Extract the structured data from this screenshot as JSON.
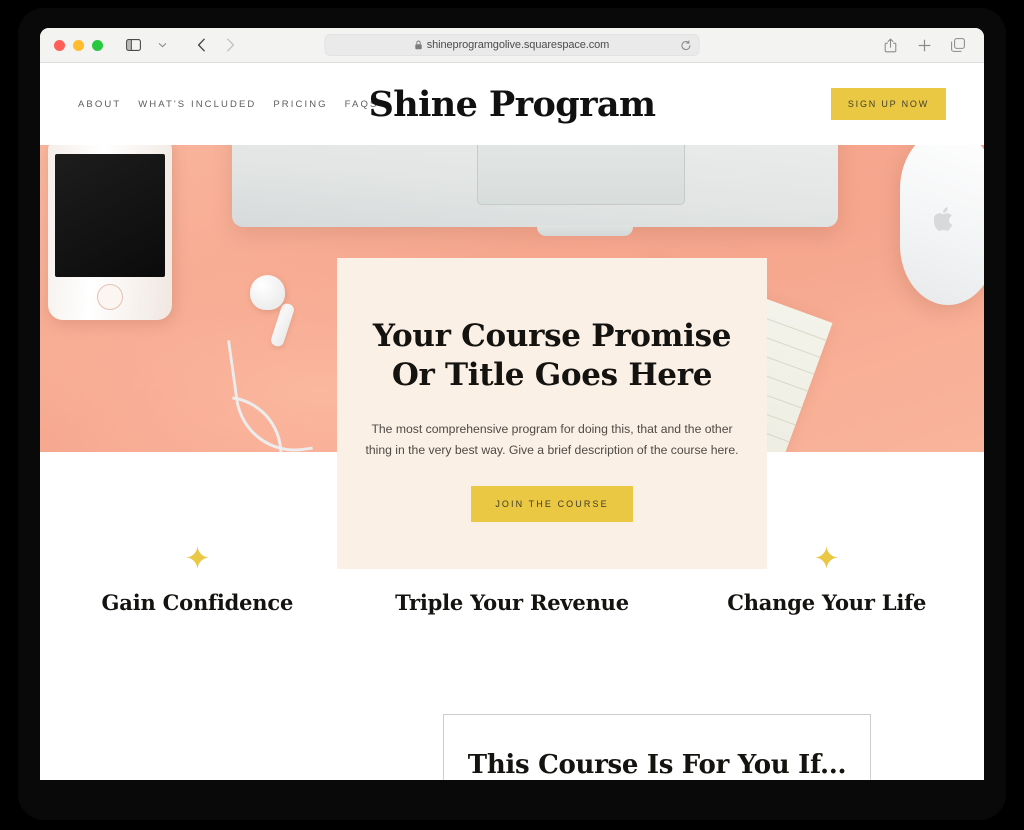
{
  "browser": {
    "url": "shineprogramgolive.squarespace.com",
    "lock_icon": "lock-icon",
    "reload_icon": "reload-icon",
    "sidebar_icon": "sidebar-toggle-icon",
    "chevron_icon": "chevron-down-icon",
    "back_icon": "back-arrow-icon",
    "forward_icon": "forward-arrow-icon",
    "share_icon": "share-icon",
    "newtab_icon": "plus-icon",
    "tabs_icon": "tab-overview-icon"
  },
  "site": {
    "logo": "Shine Program",
    "nav": [
      {
        "label": "ABOUT"
      },
      {
        "label": "WHAT'S INCLUDED"
      },
      {
        "label": "PRICING"
      },
      {
        "label": "FAQS"
      }
    ],
    "signup_label": "SIGN UP NOW"
  },
  "hero": {
    "title": "Your Course Promise Or Title Goes Here",
    "description": "The most comprehensive program for doing this, that and the other thing in the very best way. Give a brief description of the course here.",
    "cta_label": "JOIN THE COURSE"
  },
  "features": [
    {
      "icon": "sparkle-star-icon",
      "title": "Gain Confidence"
    },
    {
      "icon": "sparkle-star-icon",
      "title": "Triple Your Revenue"
    },
    {
      "icon": "sparkle-star-icon",
      "title": "Change Your Life"
    }
  ],
  "for_you": {
    "title": "This Course Is For You If..."
  },
  "colors": {
    "accent_yellow": "#eac843",
    "card_cream": "#fbf0e6",
    "desk_peach": "#f8ad94",
    "text_dark": "#15130f"
  }
}
